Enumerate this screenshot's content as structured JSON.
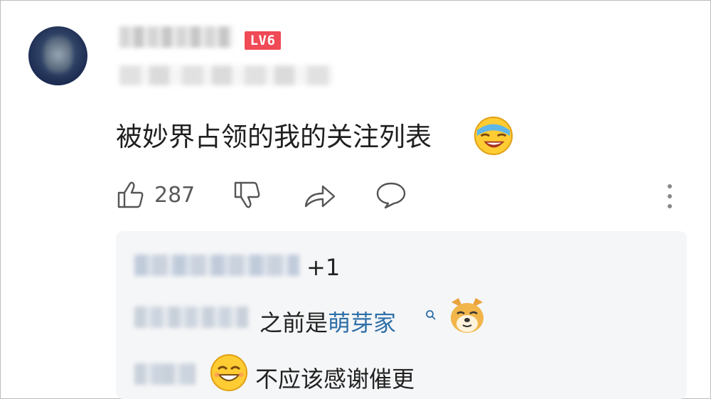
{
  "comment": {
    "level_badge": "LV6",
    "text": "被妙界占领的我的关注列表",
    "emoji": "laughing-crying-emoji",
    "like_count": "287"
  },
  "icons": {
    "like": "thumbs-up-icon",
    "dislike": "thumbs-down-icon",
    "share": "share-icon",
    "reply": "comment-icon",
    "more": "more-vertical-icon"
  },
  "colors": {
    "level_badge": "#ef4a55",
    "link": "#2f6fa8",
    "reply_bg": "#f5f6f7"
  },
  "replies": [
    {
      "text": "+1"
    },
    {
      "text_before": "之前是",
      "link": "萌芽家",
      "emoji": "doge-emoji"
    },
    {
      "emoji": "grin-emoji",
      "text": "不应该感谢催更"
    }
  ]
}
